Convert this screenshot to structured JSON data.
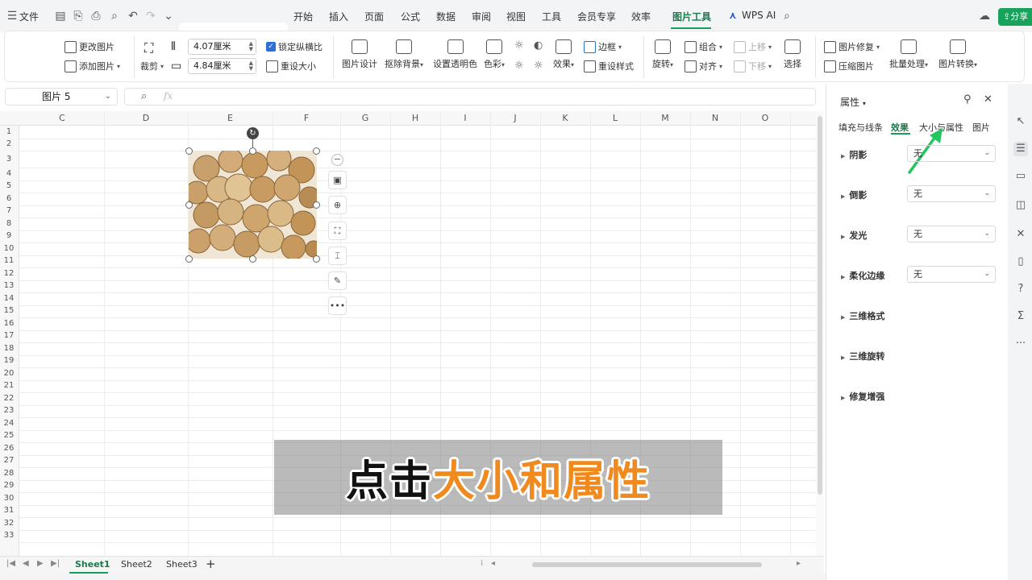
{
  "menubar": {
    "file": "文件",
    "tabs": [
      "开始",
      "插入",
      "页面",
      "公式",
      "数据",
      "审阅",
      "视图",
      "工具",
      "会员专享",
      "效率",
      "图片工具"
    ],
    "wps_ai": "WPS AI",
    "share": "分享"
  },
  "ribbon": {
    "change_picture": "更改图片",
    "add_picture": "添加图片",
    "crop": "裁剪",
    "width": "4.07厘米",
    "height": "4.84厘米",
    "lock_ratio": "锁定纵横比",
    "reset_size": "重设大小",
    "picture_design": "图片设计",
    "remove_bg": "抠除背景",
    "set_transparent": "设置透明色",
    "color": "色彩",
    "border": "边框",
    "effects": "效果",
    "reset_style": "重设样式",
    "rotate": "旋转",
    "group": "组合",
    "align": "对齐",
    "move_up": "上移",
    "move_down": "下移",
    "select": "选择",
    "repair": "图片修复",
    "compress": "压缩图片",
    "batch": "批量处理",
    "convert": "图片转换"
  },
  "formula_bar": {
    "name_box": "图片 5",
    "fx": "fx"
  },
  "grid": {
    "columns": [
      "C",
      "D",
      "E",
      "F",
      "G",
      "H",
      "I",
      "J",
      "K",
      "L",
      "M",
      "N",
      "O"
    ],
    "rows": [
      "1",
      "2",
      "3",
      "4",
      "5",
      "6",
      "7",
      "8",
      "9",
      "10",
      "11",
      "12",
      "13",
      "14",
      "15",
      "16",
      "17",
      "18",
      "19",
      "20",
      "21",
      "22",
      "23",
      "24",
      "25",
      "26",
      "27",
      "28",
      "29",
      "30",
      "31",
      "32",
      "33"
    ]
  },
  "caption": {
    "part1": "点击",
    "part2": "大小和属性"
  },
  "sheets": [
    "Sheet1",
    "Sheet2",
    "Sheet3"
  ],
  "properties": {
    "title": "属性",
    "tabs": [
      "填充与线条",
      "效果",
      "大小与属性",
      "图片"
    ],
    "rows": [
      {
        "label": "阴影",
        "value": "无"
      },
      {
        "label": "倒影",
        "value": "无"
      },
      {
        "label": "发光",
        "value": "无"
      },
      {
        "label": "柔化边缘",
        "value": "无"
      },
      {
        "label": "三维格式"
      },
      {
        "label": "三维旋转"
      },
      {
        "label": "修复增强"
      }
    ]
  },
  "colors": {
    "accent": "#1a9c5a",
    "arrow": "#22c55e",
    "caption_highlight": "#f08a1e"
  }
}
